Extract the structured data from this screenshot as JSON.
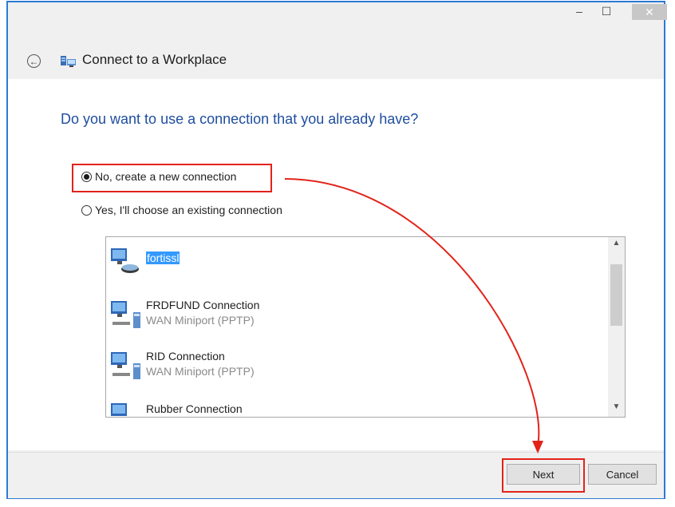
{
  "window": {
    "title": "Connect to a Workplace",
    "controls": {
      "minimize": "–",
      "maximize": "☐",
      "close": "✕"
    }
  },
  "header": {
    "back_icon": "back-arrow-icon"
  },
  "main": {
    "question": "Do you want to use a connection that you already have?",
    "options": [
      {
        "label": "No, create a new connection",
        "selected": true
      },
      {
        "label": "Yes, I'll choose an existing connection",
        "selected": false
      }
    ],
    "connections": [
      {
        "name": "fortissl",
        "type": "",
        "selected": true
      },
      {
        "name": "FRDFUND Connection",
        "type": "WAN Miniport (PPTP)",
        "selected": false
      },
      {
        "name": "RID Connection",
        "type": "WAN Miniport (PPTP)",
        "selected": false
      },
      {
        "name": "Rubber Connection",
        "type": "",
        "selected": false
      }
    ]
  },
  "footer": {
    "next_label": "Next",
    "cancel_label": "Cancel"
  },
  "colors": {
    "accent": "#2b7bd3",
    "heading": "#1f4e9f",
    "highlight": "#e2231a",
    "selection": "#3399ff"
  }
}
